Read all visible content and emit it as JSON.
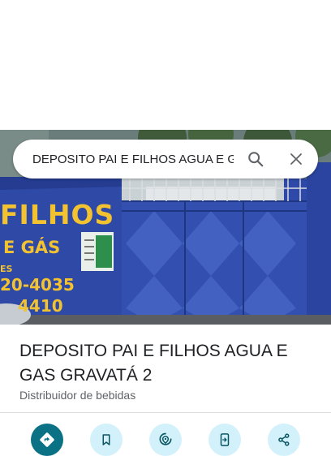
{
  "search": {
    "query": "DEPOSITO PAI E FILHOS AGUA E GAS GRAVATÁ 2"
  },
  "hero": {
    "sign_line1": "FILHOS",
    "sign_line2": "E GÁS",
    "sign_line3": "ES",
    "sign_line4": "20-4035",
    "sign_line5": "4410"
  },
  "place": {
    "name": "DEPOSITO PAI E FILHOS AGUA E GAS GRAVATÁ 2",
    "category": "Distribuidor de bebidas"
  },
  "actions": [
    {
      "icon": "directions-icon"
    },
    {
      "icon": "save-icon"
    },
    {
      "icon": "nearby-icon"
    },
    {
      "icon": "send-to-phone-icon"
    },
    {
      "icon": "share-icon"
    }
  ],
  "colors": {
    "primary": "#0b7285",
    "action_bg": "#d2f1fb",
    "wall": "#2e49a8",
    "sign_text": "#f2c230"
  }
}
